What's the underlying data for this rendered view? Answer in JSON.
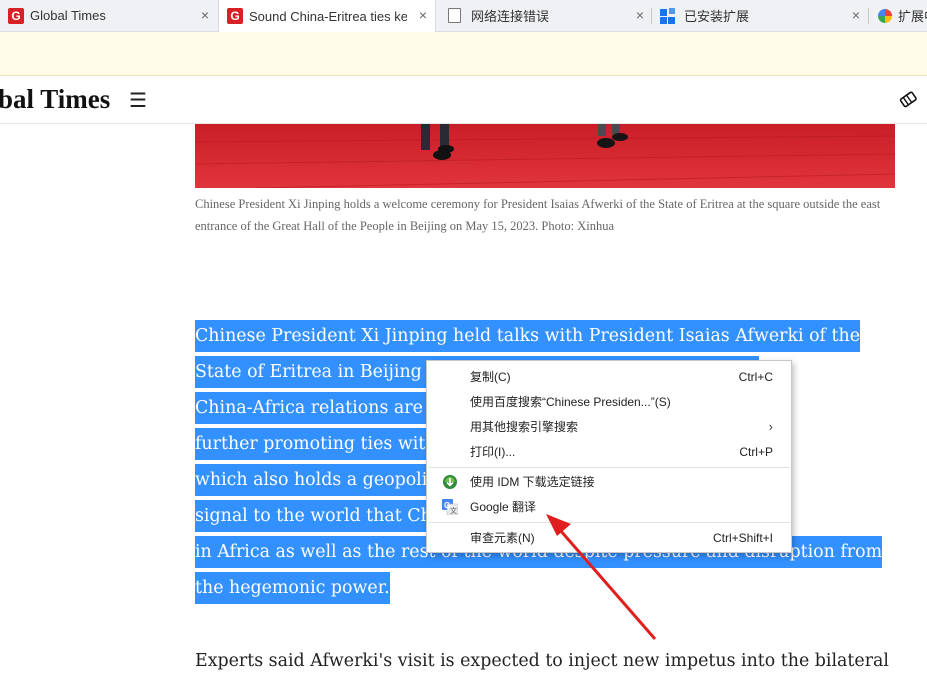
{
  "tabs": [
    {
      "title": "Global Times",
      "icon": "global-times-logo-icon",
      "close": "×"
    },
    {
      "title": "Sound China-Eritrea ties ke",
      "icon": "global-times-logo-icon",
      "close": "×"
    },
    {
      "title": "网络连接错误",
      "icon": "page-icon",
      "close": "×"
    },
    {
      "title": "已安装扩展",
      "icon": "extensions-icon",
      "close": "×"
    },
    {
      "title": "扩展中",
      "icon": "extension-center-icon"
    }
  ],
  "site": {
    "logo": "bal Times",
    "menu_icon": "☰"
  },
  "article": {
    "caption": "Chinese President Xi Jinping holds a welcome ceremony for President Isaias Afwerki of the State of Eritrea at the square outside the east entrance of the Great Hall of the People in Beijing on May 15, 2023. Photo: Xinhua",
    "para_lines": [
      " Chinese President Xi Jinping held talks with President Isaias Afwerki of the",
      "State of Eritrea in Beijing on Monday. Chinese experts said that",
      "China-Africa relations are on a trajectory of peace, and",
      "further promoting ties with Eritrea, which faces the US and",
      "which also holds a geopolitical importance in the, is a",
      "signal to the world that China and other countries",
      "in Africa as well as the rest of the world despite pressure and disruption from",
      "the hegemonic power."
    ],
    "para2": "Experts said Afwerki's visit is expected to inject new impetus into the bilateral"
  },
  "context_menu": {
    "items": [
      {
        "label": "复制(C)",
        "shortcut": "Ctrl+C"
      },
      {
        "label": "使用百度搜索“Chinese Presiden...”(S)",
        "shortcut": ""
      },
      {
        "label": "用其他搜索引擎搜索",
        "submenu_arrow": "›"
      },
      {
        "label": "打印(I)...",
        "shortcut": "Ctrl+P"
      },
      {
        "label": "使用 IDM 下载选定链接",
        "icon": "idm-icon"
      },
      {
        "label": "Google 翻译",
        "icon": "google-translate-icon"
      },
      {
        "label": "审查元素(N)",
        "shortcut": "Ctrl+Shift+I"
      }
    ]
  },
  "colors": {
    "selection": "#3390ff",
    "brand_red": "#d82127",
    "arrow": "#e01e1e",
    "notice_bg": "#fefbe8"
  }
}
